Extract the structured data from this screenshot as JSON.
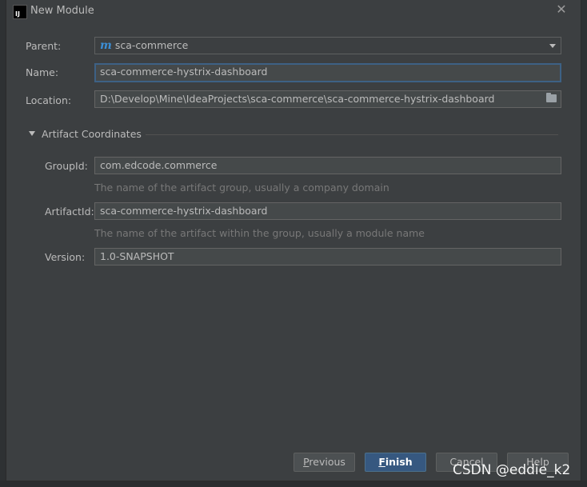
{
  "window": {
    "title": "New Module",
    "app_icon_text": "IJ"
  },
  "form": {
    "parent": {
      "label": "Parent:",
      "value": "sca-commerce",
      "icon": "m-icon"
    },
    "name": {
      "label": "Name:",
      "value": "sca-commerce-hystrix-dashboard"
    },
    "location": {
      "label": "Location:",
      "value": "D:\\Develop\\Mine\\IdeaProjects\\sca-commerce\\sca-commerce-hystrix-dashboard"
    }
  },
  "artifact": {
    "section_label": "Artifact Coordinates",
    "group_id": {
      "label": "GroupId:",
      "value": "com.edcode.commerce",
      "hint": "The name of the artifact group, usually a company domain"
    },
    "artifact_id": {
      "label": "ArtifactId:",
      "value": "sca-commerce-hystrix-dashboard",
      "hint": "The name of the artifact within the group, usually a module name"
    },
    "version": {
      "label": "Version:",
      "value": "1.0-SNAPSHOT"
    }
  },
  "buttons": {
    "previous": {
      "mnemonic": "P",
      "rest": "revious"
    },
    "finish": {
      "mnemonic": "F",
      "rest": "inish"
    },
    "cancel": "Cancel",
    "help": "Help"
  },
  "watermark": "CSDN @eddie_k2",
  "colors": {
    "accent": "#365880",
    "focus_border": "#3d6185",
    "background": "#3c3f41"
  }
}
